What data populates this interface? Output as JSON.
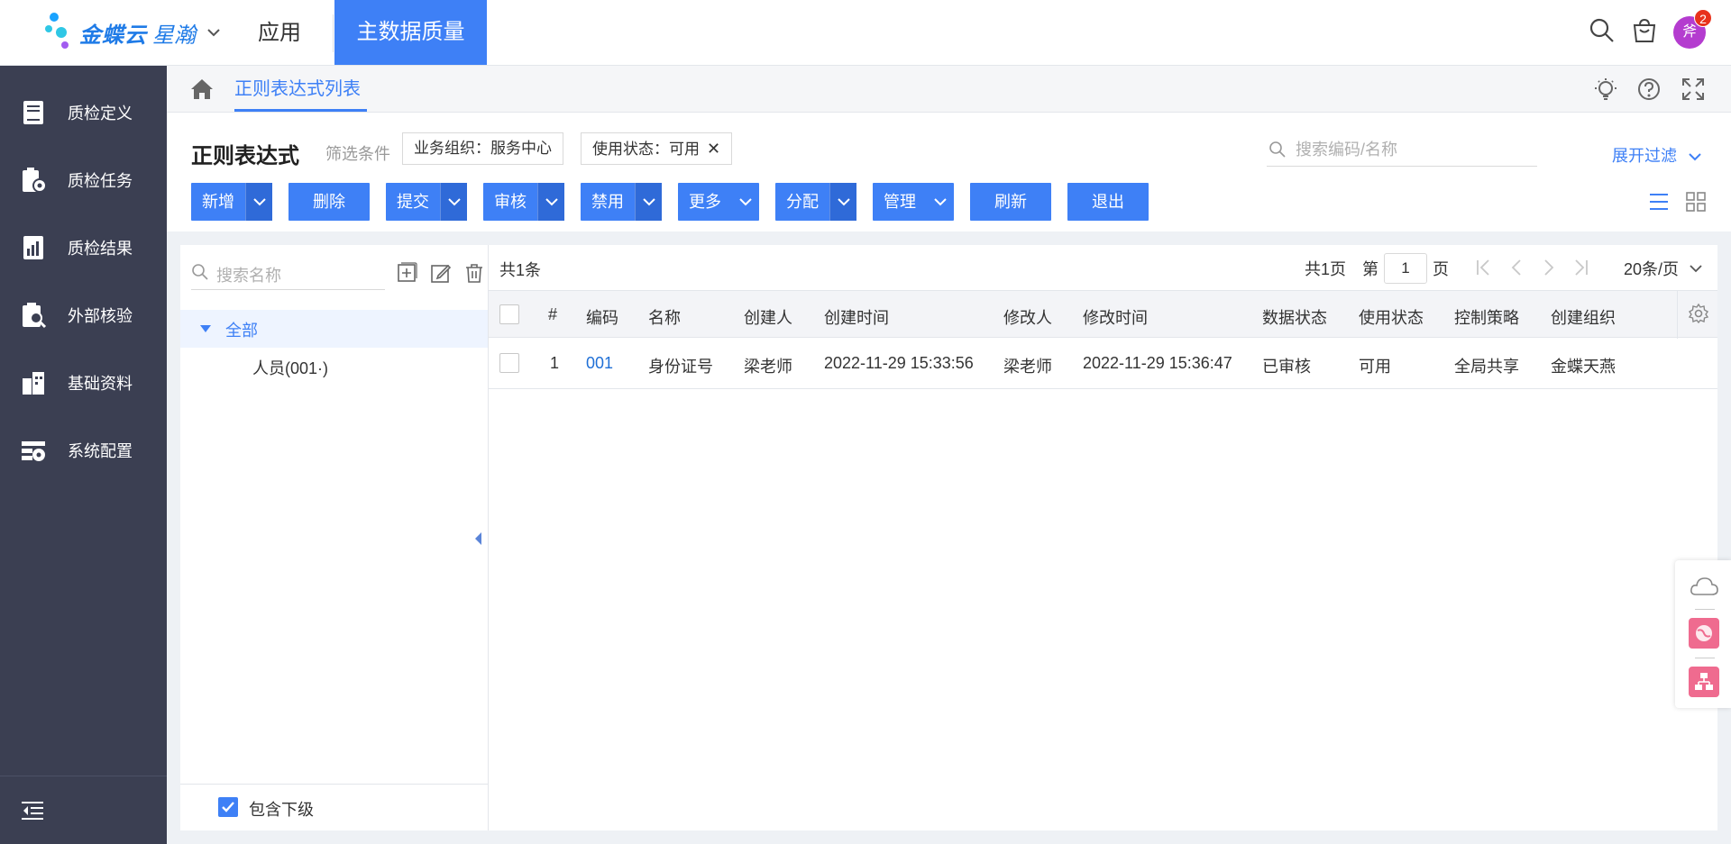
{
  "brand": {
    "name": "金蝶云",
    "product": "星瀚"
  },
  "nav": {
    "app": "应用",
    "active": "主数据质量"
  },
  "user": {
    "avatar_text": "斧",
    "badge": "2"
  },
  "sidebar": {
    "items": [
      {
        "label": "质检定义",
        "icon": "book-icon"
      },
      {
        "label": "质检任务",
        "icon": "task-clipboard-icon"
      },
      {
        "label": "质检结果",
        "icon": "report-icon"
      },
      {
        "label": "外部核验",
        "icon": "clipboard-search-icon"
      },
      {
        "label": "基础资料",
        "icon": "building-icon"
      },
      {
        "label": "系统配置",
        "icon": "settings-panel-icon"
      }
    ]
  },
  "breadcrumb": {
    "tab": "正则表达式列表"
  },
  "header": {
    "title": "正则表达式",
    "filter_label": "筛选条件",
    "filters": [
      "业务组织：服务中心",
      "使用状态：可用"
    ],
    "search_placeholder": "搜索编码/名称",
    "expand_filter": "展开过滤"
  },
  "toolbar": {
    "new": "新增",
    "delete": "删除",
    "submit": "提交",
    "audit": "审核",
    "disable": "禁用",
    "more": "更多",
    "assign": "分配",
    "manage": "管理",
    "refresh": "刷新",
    "exit": "退出"
  },
  "tree": {
    "search_placeholder": "搜索名称",
    "root": "全部",
    "children": [
      "人员(001·)"
    ],
    "include_sub": "包含下级",
    "include_sub_checked": true
  },
  "table": {
    "total": "共1条",
    "pages_total": "共1页",
    "page_prefix": "第",
    "page_current": "1",
    "page_suffix": "页",
    "page_size": "20条/页",
    "columns": [
      "#",
      "编码",
      "名称",
      "创建人",
      "创建时间",
      "修改人",
      "修改时间",
      "数据状态",
      "使用状态",
      "控制策略",
      "创建组织"
    ],
    "rows": [
      {
        "idx": "1",
        "code": "001",
        "name": "身份证号",
        "creator": "梁老师",
        "created": "2022-11-29 15:33:56",
        "modifier": "梁老师",
        "modified": "2022-11-29 15:36:47",
        "data_status": "已审核",
        "use_status": "可用",
        "policy": "全局共享",
        "org": "金蝶天燕"
      }
    ]
  },
  "colors": {
    "primary": "#3e80f6",
    "sidebar_bg": "#3b3f52",
    "link": "#1f6fd6"
  }
}
